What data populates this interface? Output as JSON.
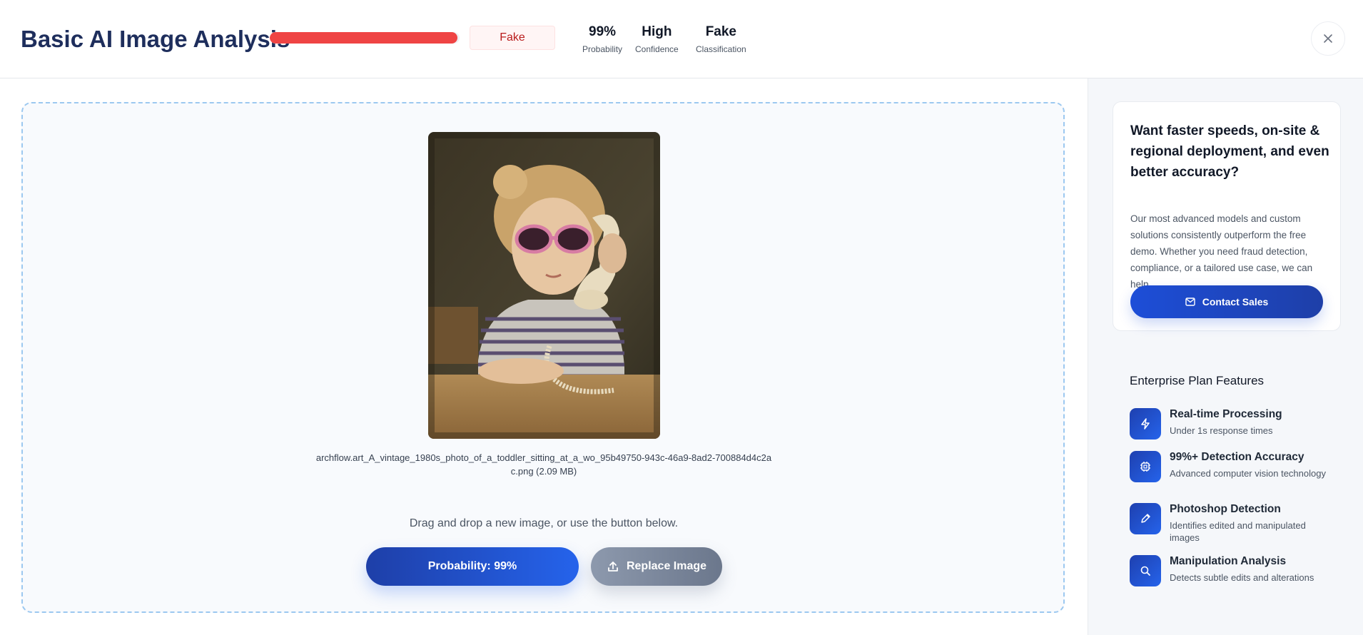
{
  "header": {
    "title": "Basic AI Image Analysis",
    "probability_fill": 0.99,
    "probability_color": "#ef4444",
    "badge": "Fake",
    "stats": [
      {
        "value": "99%",
        "label": "Probability"
      },
      {
        "value": "High",
        "label": "Confidence"
      },
      {
        "value": "Fake",
        "label": "Classification"
      }
    ],
    "close_icon": "close-icon"
  },
  "upload": {
    "file_name_line1": "archflow.art_A_vintage_1980s_photo_of_a_toddler_sitting_at_a_wo_95b49750-943c-46a9-8ad2-700884d4c2a",
    "file_name_line2": "c.png (2.09 MB)",
    "hint": "Drag and drop a new image, or use the button below.",
    "probability_button": "Probability: 99%",
    "replace_button": "Replace Image",
    "replace_icon": "upload-icon"
  },
  "sidebar": {
    "promo_title": "Want faster speeds, on-site & regional deployment, and even better accuracy?",
    "promo_body": "Our most advanced models and custom solutions consistently outperform the free demo. Whether you need fraud detection, compliance, or a tailored use case, we can help.",
    "contact_button": "Contact Sales",
    "contact_icon": "mail-icon",
    "features_heading": "Enterprise Plan Features",
    "features": [
      {
        "icon": "lightning-icon",
        "title": "Real-time Processing",
        "desc": "Under 1s response times"
      },
      {
        "icon": "chip-icon",
        "title": "99%+ Detection Accuracy",
        "desc": "Advanced computer vision technology"
      },
      {
        "icon": "pencil-icon",
        "title": "Photoshop Detection",
        "desc": "Identifies edited and manipulated images"
      },
      {
        "icon": "search-icon",
        "title": "Manipulation Analysis",
        "desc": "Detects subtle edits and alterations"
      }
    ]
  },
  "colors": {
    "brand_blue": "#1d4ed8",
    "title_navy": "#1e2e5c",
    "dropzone_border": "#9cc8f0"
  }
}
